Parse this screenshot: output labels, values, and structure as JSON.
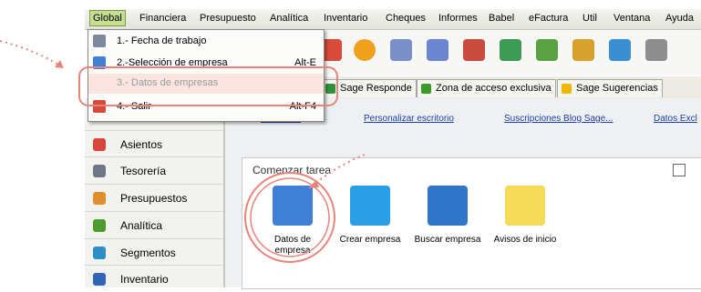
{
  "menubar": {
    "items": [
      "Global",
      "Financiera",
      "Presupuesto",
      "Analítica",
      "Inventario",
      "Cheques",
      "Informes",
      "Babel",
      "eFactura",
      "Util",
      "Ventana",
      "Ayuda"
    ]
  },
  "dropdown": {
    "items": [
      {
        "label": "1.- Fecha de trabajo",
        "shortcut": "",
        "icon": "calendar-icon"
      },
      {
        "label": "2.-Selección de empresa",
        "shortcut": "Alt-E",
        "icon": "company-select-icon"
      },
      {
        "label": "3.- Datos de empresas",
        "shortcut": "",
        "icon": "company-data-icon"
      },
      {
        "label": "4.- Salir",
        "shortcut": "Alt-F4",
        "icon": "exit-icon"
      }
    ]
  },
  "tabs": [
    {
      "label": "Sage Responde",
      "icon": "sage-responde-icon",
      "color": "#2f8f3a"
    },
    {
      "label": "Zona de acceso exclusiva",
      "icon": "exclusive-zone-icon",
      "color": "#3a9a2a"
    },
    {
      "label": "Sage Sugerencias",
      "icon": "suggestions-icon",
      "color": "#f0b800"
    }
  ],
  "links": [
    "Actualizar",
    "Personalizar escritorio",
    "Suscripciones Blog Sage...",
    "Datos Excl"
  ],
  "sidebar": {
    "items": [
      {
        "label": "Asientos",
        "icon": "asientos-icon",
        "color": "#d7453b"
      },
      {
        "label": "Tesorería",
        "icon": "tesoreria-icon",
        "color": "#6d7785"
      },
      {
        "label": "Presupuestos",
        "icon": "presupuestos-icon",
        "color": "#e0902a"
      },
      {
        "label": "Analítica",
        "icon": "analitica-icon",
        "color": "#4f9a2c"
      },
      {
        "label": "Segmentos",
        "icon": "segmentos-icon",
        "color": "#2c8ec4"
      },
      {
        "label": "Inventario",
        "icon": "inventario-icon",
        "color": "#3066b8"
      }
    ]
  },
  "panel": {
    "title": "Comenzar tarea",
    "tasks": [
      {
        "label": "Datos de empresa",
        "icon": "company-data-icon"
      },
      {
        "label": "Crear empresa",
        "icon": "create-company-icon"
      },
      {
        "label": "Buscar empresa",
        "icon": "search-company-icon"
      },
      {
        "label": "Avisos de inicio",
        "icon": "sticky-note-icon"
      }
    ]
  },
  "colors": {
    "accent": "#e8847a",
    "link": "#1a3fa8",
    "menu_active": "#c6dd92"
  }
}
